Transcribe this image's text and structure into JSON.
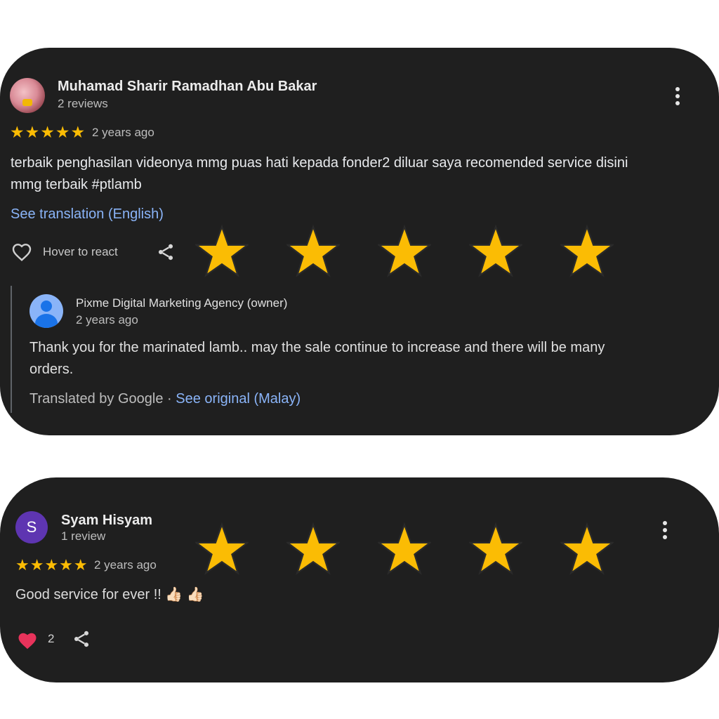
{
  "review1": {
    "author": "Muhamad Sharir Ramadhan Abu Bakar",
    "author_meta": "2 reviews",
    "rating_stars": "★★★★★",
    "rating": 5,
    "time": "2 years ago",
    "text_line1": "terbaik penghasilan videonya mmg puas hati kepada fonder2 diluar saya recomended service disini",
    "text_line2": "mmg terbaik #ptlamb",
    "translation_link": "See translation (English)",
    "react_label": "Hover to react",
    "owner_reply": {
      "author": "Pixme Digital Marketing Agency (owner)",
      "time": "2 years ago",
      "text_line1": "Thank you for the marinated lamb.. may the sale continue to increase and there will be many",
      "text_line2": "orders.",
      "translated_by": "Translated by Google ·",
      "see_original": "See original (Malay)"
    }
  },
  "review2": {
    "avatar_letter": "S",
    "author": "Syam Hisyam",
    "author_meta": "1 review",
    "rating_stars": "★★★★★",
    "rating": 5,
    "time": "2 years ago",
    "text": "Good service for ever !! 👍🏻 👍🏻",
    "reaction_count": "2"
  },
  "overlay_stars": {
    "count_per_row": 5,
    "color": "#fbbc04",
    "outline": "#2a2a2a"
  },
  "colors": {
    "card_background": "#1f1f1f",
    "link": "#8ab4f8",
    "star": "#fbbc04"
  }
}
